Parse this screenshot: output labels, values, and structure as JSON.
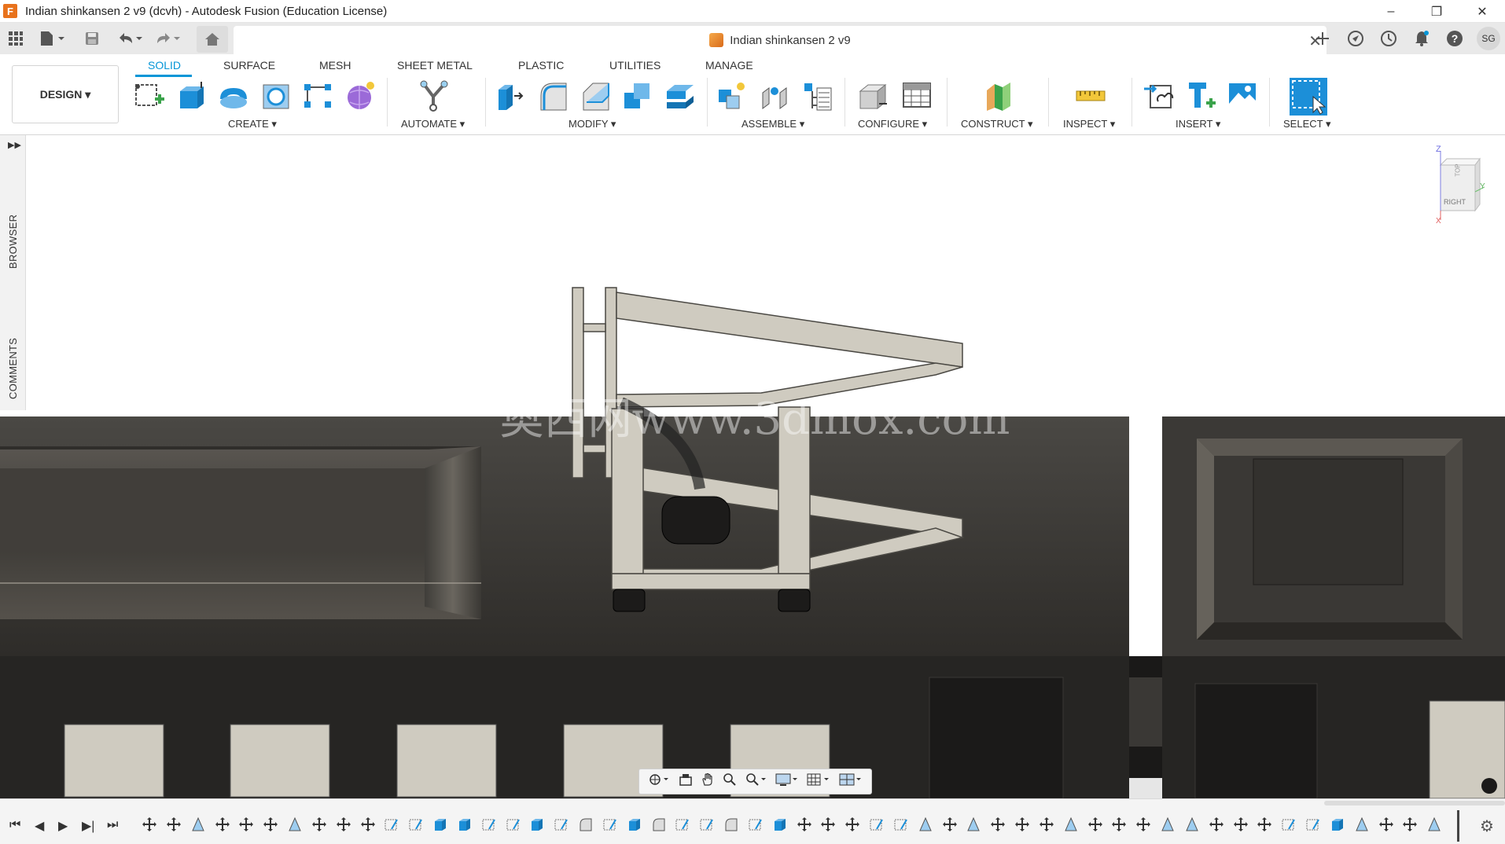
{
  "window": {
    "title": "Indian shinkansen 2 v9 (dcvh) - Autodesk Fusion (Education License)",
    "logo_letter": "F",
    "minimize": "–",
    "restore": "❐",
    "close": "✕"
  },
  "document_tab": {
    "title": "Indian shinkansen 2 v9",
    "close": "✕"
  },
  "user": {
    "initials": "SG"
  },
  "workspace": {
    "label": "DESIGN ▾"
  },
  "tabs": [
    {
      "label": "SOLID",
      "active": true
    },
    {
      "label": "SURFACE"
    },
    {
      "label": "MESH"
    },
    {
      "label": "SHEET METAL"
    },
    {
      "label": "PLASTIC"
    },
    {
      "label": "UTILITIES"
    },
    {
      "label": "MANAGE"
    }
  ],
  "groups": {
    "create": "CREATE ▾",
    "automate": "AUTOMATE ▾",
    "modify": "MODIFY ▾",
    "assemble": "ASSEMBLE ▾",
    "configure": "CONFIGURE ▾",
    "construct": "CONSTRUCT ▾",
    "inspect": "INSPECT ▾",
    "insert": "INSERT ▾",
    "select": "SELECT ▾"
  },
  "side_panel": {
    "browser": "BROWSER",
    "comments": "COMMENTS",
    "expand": "▶▶"
  },
  "viewcube": {
    "face": "RIGHT",
    "top_face": "TOP",
    "axis_z": "Z",
    "axis_y": "Y",
    "axis_x": "X"
  },
  "watermark": "奥西网www.3dmox.com",
  "timeline": {
    "first": "⏮",
    "prev": "◀",
    "play": "▶",
    "next": "▶|",
    "last": "⏭"
  },
  "colors": {
    "accent": "#0696d7",
    "model_dark": "#3a3835",
    "model_light": "#cfcbc0",
    "ribbon_bg": "#ffffff",
    "tabbar_bg": "#e9e9e9"
  }
}
